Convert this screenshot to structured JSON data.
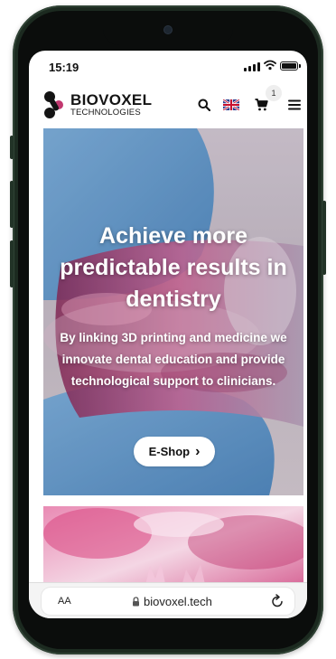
{
  "status": {
    "time": "15:19"
  },
  "header": {
    "brand": "BIOVOXEL",
    "brand_sub": "TECHNOLOGIES",
    "cart_count": "1"
  },
  "hero": {
    "title": "Achieve more predictable results in dentistry",
    "description": "By linking 3D printing and medicine we innovate dental education and provide technological support to clinicians.",
    "cta_label": "E-Shop",
    "cta_chevron": "›"
  },
  "browser": {
    "text_size_label": "AA",
    "url": "biovoxel.tech"
  },
  "icons": {
    "search": "search-icon",
    "language": "uk-flag-icon",
    "cart": "cart-icon",
    "menu": "hamburger-menu-icon",
    "lock": "lock-icon",
    "reload": "reload-icon"
  },
  "colors": {
    "frame": "#1c2a20",
    "text_dark": "#141414",
    "glove_blue": "#6aa9d6",
    "accent_pink": "#c2386f"
  }
}
